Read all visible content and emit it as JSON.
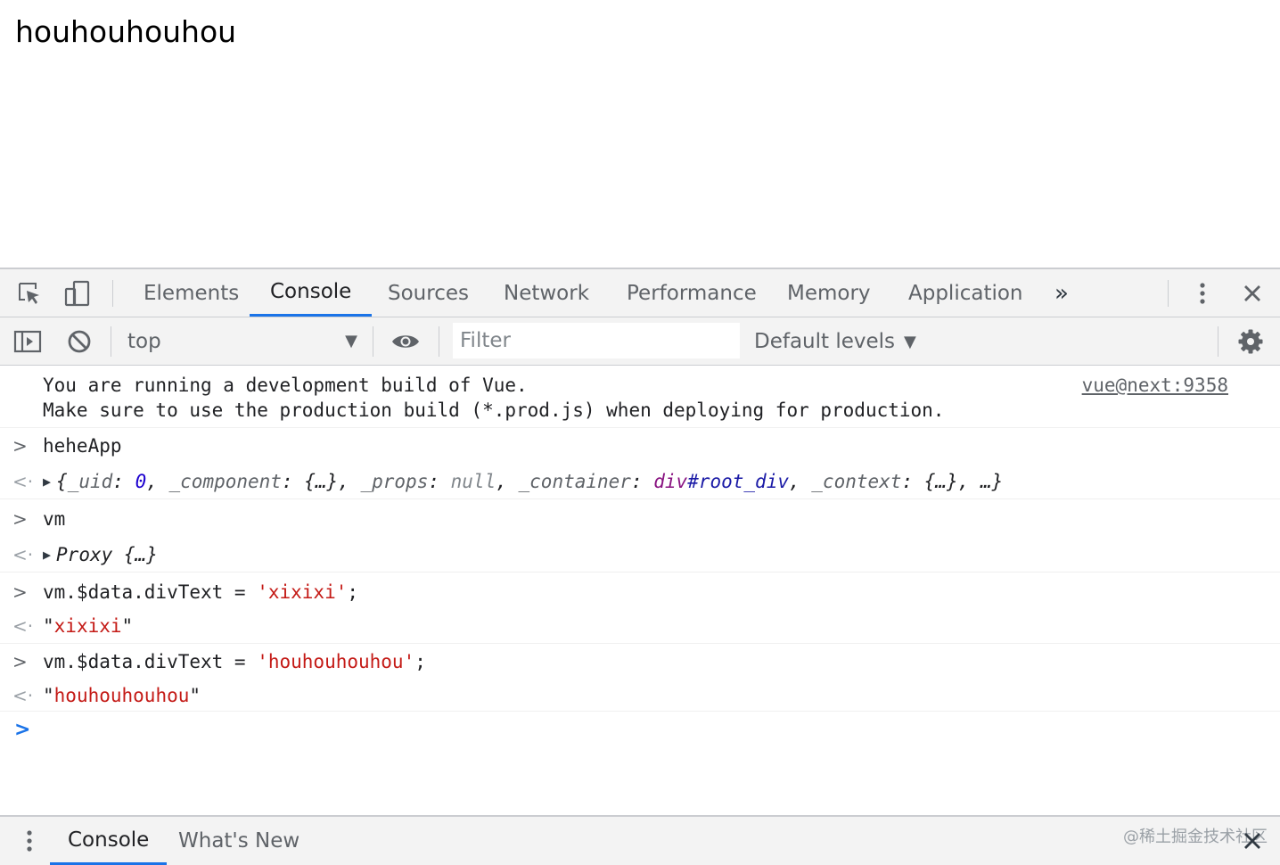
{
  "page": {
    "text": "houhouhouhou"
  },
  "tabbar": {
    "tabs": [
      "Elements",
      "Console",
      "Sources",
      "Network",
      "Performance",
      "Memory",
      "Application"
    ],
    "active_tab": "Console",
    "more_label": "»"
  },
  "toolbar": {
    "context": "top",
    "filter_placeholder": "Filter",
    "levels": "Default levels"
  },
  "console": {
    "warning": {
      "line1": "You are running a development build of Vue.",
      "line2": "Make sure to use the production build (*.prod.js) when deploying for production.",
      "source": "vue@next:9358"
    },
    "entries": [
      {
        "input": "heheApp"
      },
      {
        "input": "vm"
      },
      {
        "input_prefix": "vm.$data.divText = ",
        "input_string": "'xixixi'",
        "input_suffix": ";",
        "result": "xixixi"
      },
      {
        "input_prefix": "vm.$data.divText = ",
        "input_string": "'houhouhouhou'",
        "input_suffix": ";",
        "result": "houhouhouhou"
      }
    ],
    "heheApp_result": {
      "k1": "_uid",
      "v1": "0",
      "k2": "_component",
      "v2": "{…}",
      "k3": "_props",
      "v3": "null",
      "k4": "_container",
      "v4_tag": "div",
      "v4_id": "#root_div",
      "k5": "_context",
      "v5": "{…}",
      "rest": "…"
    },
    "vm_result": {
      "type": "Proxy",
      "value": "{…}"
    }
  },
  "drawer": {
    "tabs": [
      "Console",
      "What's New"
    ],
    "active_tab": "Console"
  },
  "watermark": "@稀土掘金技术社区"
}
